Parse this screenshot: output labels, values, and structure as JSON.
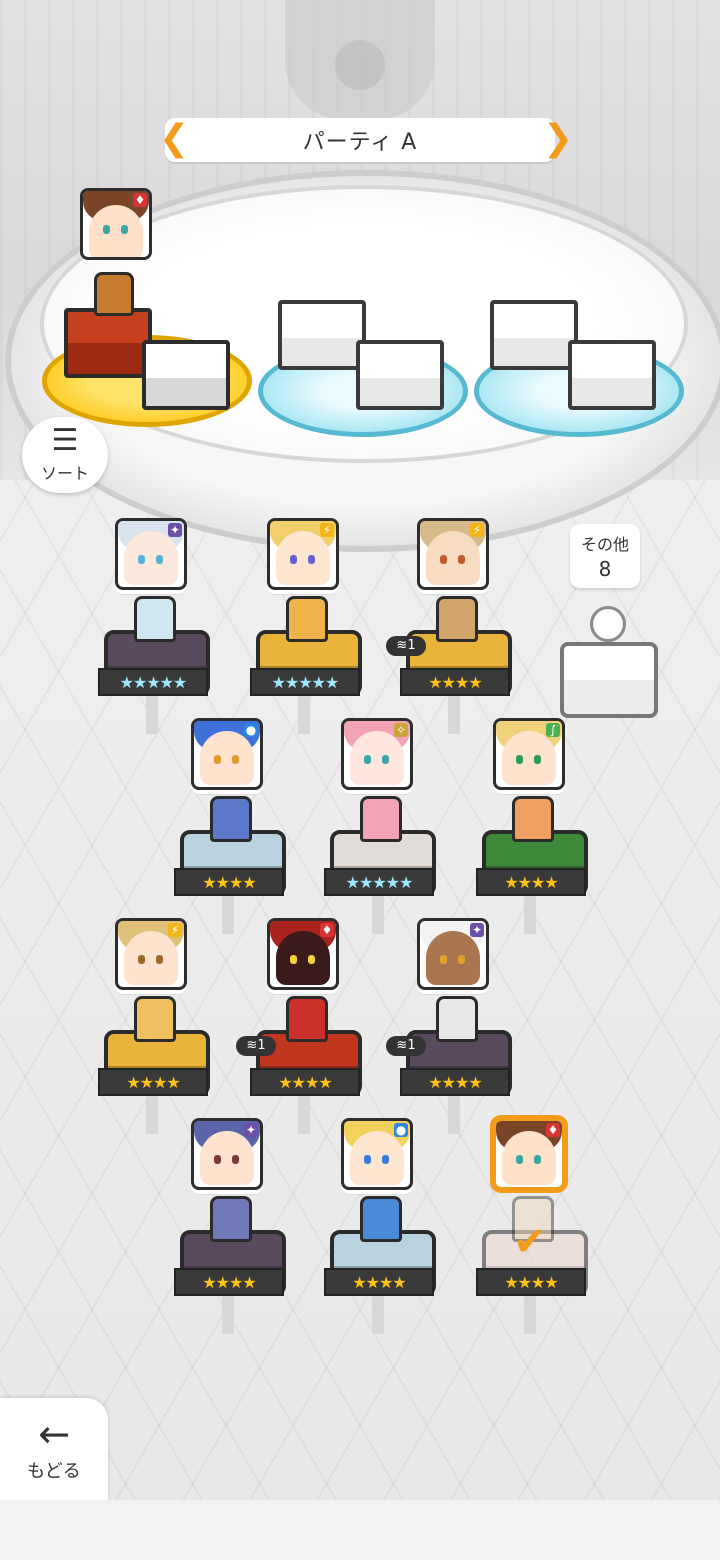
{
  "header": {
    "party_title": "パーティ A"
  },
  "sort_button": {
    "label": "ソート"
  },
  "back_button": {
    "label": "もどる"
  },
  "others": {
    "label": "その他",
    "count": "8"
  },
  "icons": {
    "sort": "☰",
    "back": "←",
    "arrow_left": "❮",
    "arrow_right": "❯",
    "check": "✔"
  },
  "colors": {
    "accent": "#f39c1c",
    "star_gold": "#ffc21a",
    "pad_blue": "#56b9d2"
  },
  "units": [
    {
      "id": "u1",
      "name": "silver-hair-girl",
      "element": "dark",
      "element_symbol": "✦",
      "stars": "★★★★★",
      "star_style": "rainbow",
      "limit": ""
    },
    {
      "id": "u2",
      "name": "blonde-witch",
      "element": "thunder",
      "element_symbol": "⚡",
      "stars": "★★★★★",
      "star_style": "rainbow",
      "limit": ""
    },
    {
      "id": "u3",
      "name": "blonde-woman",
      "element": "thunder",
      "element_symbol": "⚡",
      "stars": "★★★★",
      "star_style": "gold",
      "limit": "1"
    },
    {
      "id": "u4",
      "name": "blue-hair-girl",
      "element": "water",
      "element_symbol": "●",
      "stars": "★★★★",
      "star_style": "gold",
      "limit": ""
    },
    {
      "id": "u5",
      "name": "pink-hair-girl",
      "element": "light",
      "element_symbol": "✧",
      "stars": "★★★★★",
      "star_style": "rainbow",
      "limit": ""
    },
    {
      "id": "u6",
      "name": "elf-girl",
      "element": "wind",
      "element_symbol": "∫",
      "stars": "★★★★",
      "star_style": "gold",
      "limit": ""
    },
    {
      "id": "u7",
      "name": "glasses-girl",
      "element": "thunder",
      "element_symbol": "⚡",
      "stars": "★★★★",
      "star_style": "gold",
      "limit": ""
    },
    {
      "id": "u8",
      "name": "red-armor",
      "element": "fire",
      "element_symbol": "♦",
      "stars": "★★★★",
      "star_style": "gold",
      "limit": "1"
    },
    {
      "id": "u9",
      "name": "white-hair-girl",
      "element": "dark",
      "element_symbol": "✦",
      "stars": "★★★★",
      "star_style": "gold",
      "limit": "1"
    },
    {
      "id": "u10",
      "name": "glasses-man",
      "element": "dark",
      "element_symbol": "✦",
      "stars": "★★★★",
      "star_style": "gold",
      "limit": ""
    },
    {
      "id": "u11",
      "name": "blonde-maid",
      "element": "water",
      "element_symbol": "●",
      "stars": "★★★★",
      "star_style": "gold",
      "limit": ""
    },
    {
      "id": "u12",
      "name": "brown-hair-boy",
      "element": "fire",
      "element_symbol": "♦",
      "stars": "★★★★",
      "star_style": "gold",
      "limit": "",
      "selected": true
    }
  ]
}
